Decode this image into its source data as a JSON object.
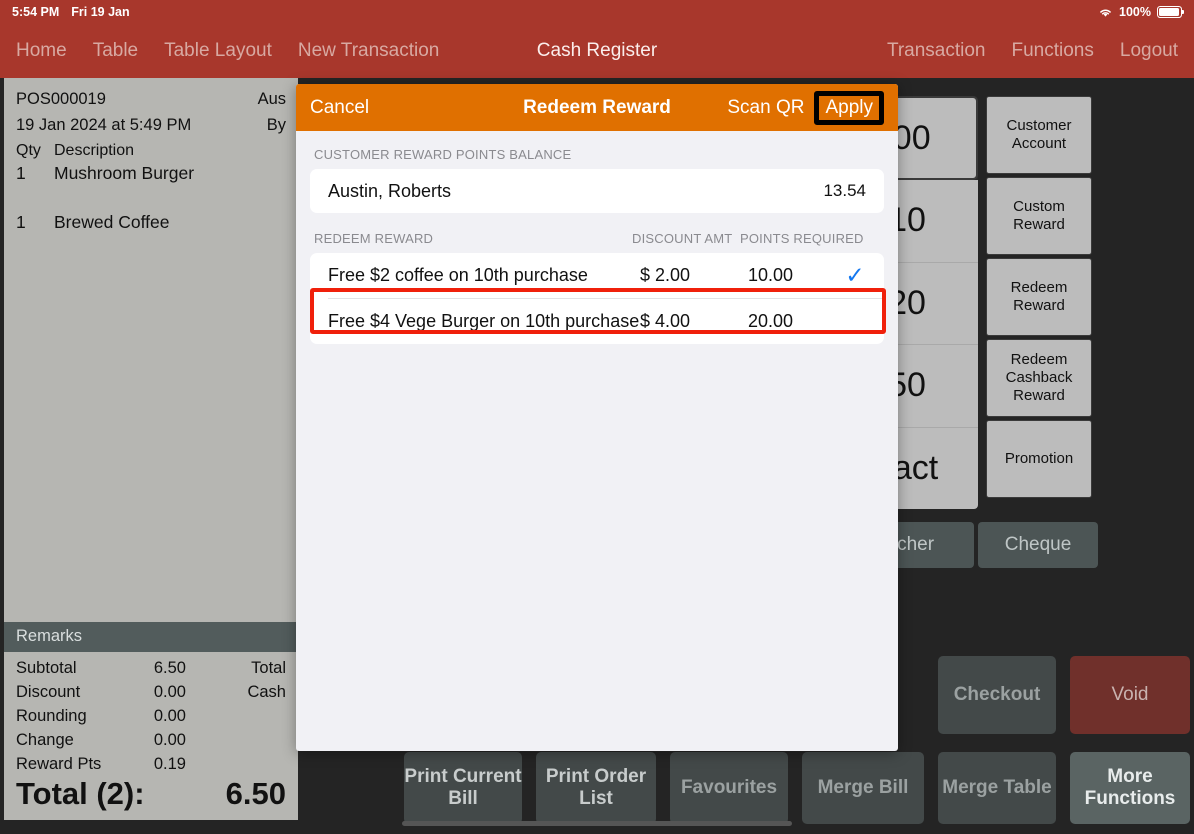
{
  "statusbar": {
    "time": "5:54 PM",
    "date": "Fri 19 Jan",
    "battery_percent": "100%"
  },
  "navbar": {
    "title": "Cash Register",
    "left_items": [
      "Home",
      "Table",
      "Table Layout",
      "New Transaction"
    ],
    "right_items": [
      "Transaction",
      "Functions",
      "Logout"
    ]
  },
  "receipt": {
    "order_no": "POS000019",
    "customer": "Aus",
    "datetime": "19 Jan 2024 at 5:49 PM",
    "served_by": "By",
    "col_qty": "Qty",
    "col_desc": "Description",
    "items": [
      {
        "qty": "1",
        "description": "Mushroom Burger"
      },
      {
        "qty": "1",
        "description": "Brewed Coffee"
      }
    ],
    "remarks_label": "Remarks",
    "totals": [
      {
        "label": "Subtotal",
        "value": "6.50",
        "right_label": "Total"
      },
      {
        "label": "Discount",
        "value": "0.00",
        "right_label": "Cash"
      },
      {
        "label": "Rounding",
        "value": "0.00",
        "right_label": ""
      },
      {
        "label": "Change",
        "value": "0.00",
        "right_label": ""
      },
      {
        "label": "Reward Pts",
        "value": "0.19",
        "right_label": ""
      }
    ],
    "grand_label": "Total (2):",
    "grand_value": "6.50"
  },
  "keypad": {
    "amounts": [
      ".00",
      "10",
      "20",
      "50",
      "xact"
    ],
    "functions": [
      "Customer Account",
      "Custom Reward",
      "Redeem Reward",
      "Redeem Cashback Reward",
      "Promotion"
    ],
    "payments": [
      "oucher",
      "Cheque"
    ]
  },
  "actions": {
    "print_current_bill": "Print Current Bill",
    "print_order_list": "Print Order List",
    "favourites": "Favourites",
    "merge_bill": "Merge Bill",
    "merge_table": "Merge Table",
    "checkout": "Checkout",
    "void": "Void",
    "more_functions": "More Functions"
  },
  "modal": {
    "cancel": "Cancel",
    "title": "Redeem Reward",
    "scan_qr": "Scan QR",
    "apply": "Apply",
    "balance_section_label": "CUSTOMER REWARD POINTS BALANCE",
    "balance_name": "Austin, Roberts",
    "balance_value": "13.54",
    "list_header": {
      "name": "REDEEM REWARD",
      "discount": "DISCOUNT AMT",
      "points": "POINTS REQUIRED"
    },
    "rewards": [
      {
        "name": "Free $2 coffee on 10th purchase",
        "discount": "$ 2.00",
        "points": "10.00",
        "selected": "✓"
      },
      {
        "name": "Free $4 Vege Burger on 10th purchase",
        "discount": "$ 4.00",
        "points": "20.00",
        "selected": ""
      }
    ]
  },
  "colors": {
    "brand_red": "#A8372C",
    "accent_orange": "#E07000",
    "highlight_red": "#F0200B",
    "check_blue": "#1478F0",
    "void_red": "#70302B"
  }
}
